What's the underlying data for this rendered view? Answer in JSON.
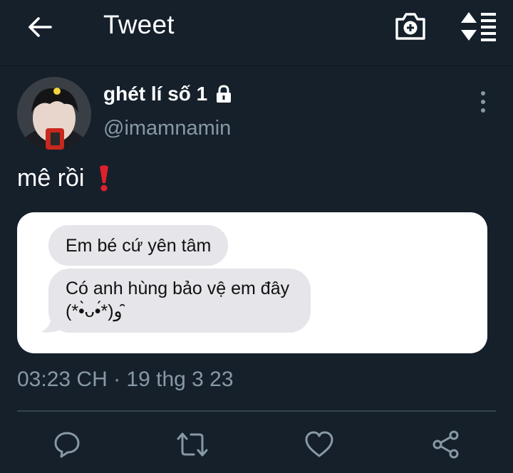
{
  "header": {
    "title": "Tweet",
    "back_icon": "arrow-left-icon",
    "camera_icon": "camera-add-icon",
    "sort_icon": "sort-list-icon"
  },
  "tweet": {
    "display_name": "ghét lí số 1",
    "handle": "@imamnamin",
    "text": "mê rồi",
    "protected_icon": "lock-icon",
    "emoji": "red-exclamation-icon",
    "timestamp": "03:23 CH · 19 thg 3 23"
  },
  "media": {
    "bubbles": [
      "Em bé cứ yên tâm",
      "Có anh hùng bảo vệ em đây (*•̀ᴗ•́*)و ̑̑"
    ]
  },
  "actions": [
    "reply-icon",
    "retweet-icon",
    "heart-icon",
    "share-icon"
  ],
  "colors": {
    "background": "#15202b",
    "secondary_text": "#8899a6",
    "divider": "#38444d",
    "bubble": "#e5e5ea",
    "exclamation": "#e0202b"
  }
}
